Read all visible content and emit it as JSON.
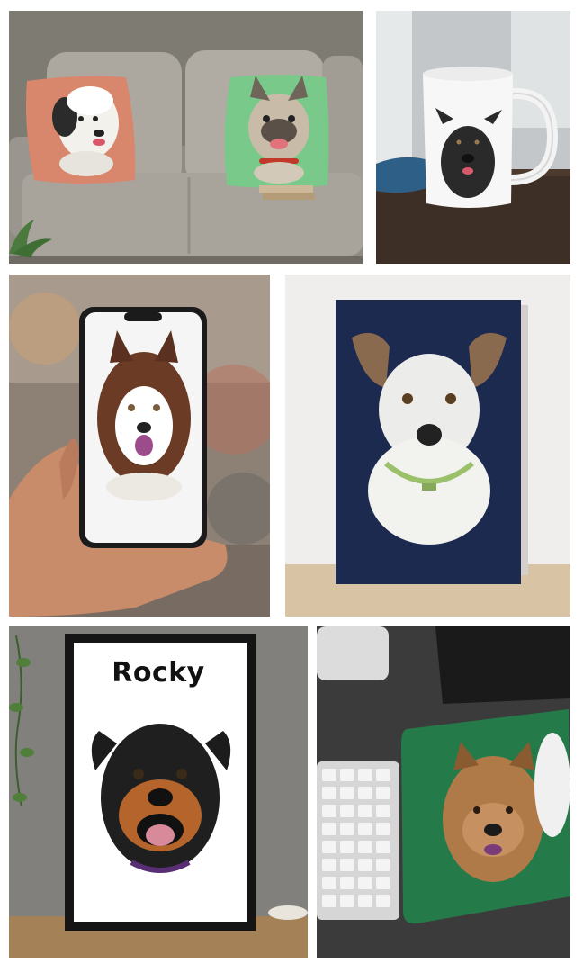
{
  "collage": {
    "panels": [
      {
        "product": "cushions",
        "scene": "sofa"
      },
      {
        "product": "mug",
        "scene": "table"
      },
      {
        "product": "phone-case",
        "scene": "hand"
      },
      {
        "product": "canvas",
        "scene": "wall"
      },
      {
        "product": "framed-print",
        "scene": "shelf"
      },
      {
        "product": "mouse-pad",
        "scene": "desk"
      }
    ]
  },
  "frame": {
    "pet_name": "Rocky"
  },
  "colors": {
    "pillow_left": "#d9876c",
    "pillow_right": "#79c98a",
    "canvas_navy": "#1d2a4f",
    "mousepad_green": "#257a4a",
    "sofa": "#a9a49d"
  }
}
